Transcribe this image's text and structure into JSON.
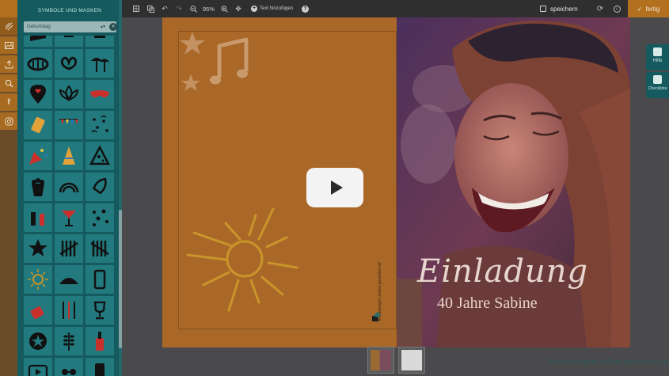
{
  "toolbar": {
    "zoom_value": "95%",
    "add_text_label": "Text hinzufügen",
    "save_label": "speichern",
    "done_label": "fertig"
  },
  "panel": {
    "title": "SYMBOLE UND MASKEN",
    "category_selected": "Geburtstag"
  },
  "card": {
    "headline": "Einladung",
    "subline": "40 Jahre Sabine",
    "side_text": "Einladungen-selbst-gestalten.de"
  },
  "help": {
    "help_label": "Hilfe",
    "checklist_label": "Checkliste"
  },
  "brand": {
    "text": "Einladungen-selbst-gestalten.de"
  },
  "colors": {
    "panel_bg": "#155a5e",
    "accent_orange": "#b3701f",
    "card_orange": "#a96828"
  },
  "symbols": [
    "cake-slice-icon",
    "bell-icon",
    "cat-icon",
    "lucky-bowl-icon",
    "pretzel-icon",
    "palm-trees-icon",
    "map-pin-heart-icon",
    "lotus-icon",
    "mask-icon",
    "party-cracker-icon",
    "bunting-icon",
    "confetti-icon",
    "party-popper-icon",
    "party-hat-icon",
    "pizza-slice-icon",
    "popcorn-icon",
    "rainbow-icon",
    "rocket-icon",
    "drinks-icon",
    "cocktail-icon",
    "stars-icon",
    "star-icon",
    "tally-marks-icon",
    "tally-marks-2-icon",
    "sun-icon",
    "taco-icon",
    "phone-icon",
    "dessert-icon",
    "utensils-icon",
    "trophy-icon",
    "star-badge-icon",
    "wheat-icon",
    "wine-bottle-icon",
    "play-button-icon",
    "mask-sunglasses-icon",
    "smartphone-icon"
  ]
}
